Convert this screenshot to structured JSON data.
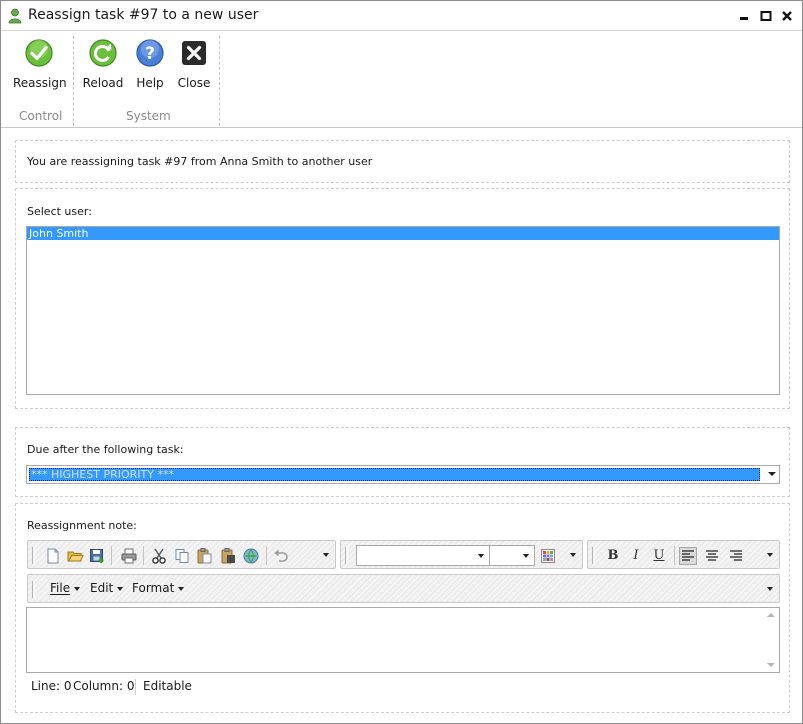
{
  "window": {
    "title": "Reassign task #97 to a new user"
  },
  "ribbon": {
    "buttons": {
      "reassign": "Reassign",
      "reload": "Reload",
      "help": "Help",
      "close": "Close"
    },
    "groups": {
      "control": "Control",
      "system": "System"
    }
  },
  "info": {
    "text": "You are reassigning task #97 from Anna Smith to another user"
  },
  "select_user": {
    "label": "Select user:",
    "items": [
      "John Smith"
    ],
    "selected_index": 0
  },
  "due_after": {
    "label": "Due after the following task:",
    "selected": "*** HIGHEST PRIORITY ***"
  },
  "note": {
    "label": "Reassignment note:",
    "menus": {
      "file": "File",
      "edit": "Edit",
      "format": "Format"
    },
    "status": {
      "line": "Line: 0",
      "column": "Column: 0",
      "mode": "Editable"
    }
  },
  "colors": {
    "selection": "#3399ff",
    "accent_green": "#5aa832",
    "accent_blue": "#3a6fd0"
  }
}
